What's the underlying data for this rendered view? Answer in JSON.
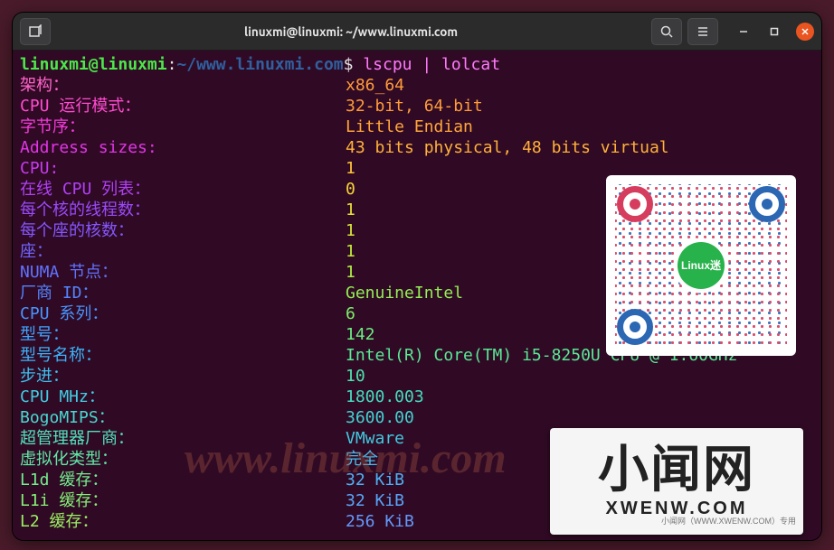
{
  "window": {
    "title": "linuxmi@linuxmi: ~/www.linuxmi.com"
  },
  "prompt": {
    "userhost": "linuxmi@linuxmi",
    "colon": ":",
    "path": "~/www.linuxmi.com",
    "dollar": "$ ",
    "command": "lscpu | lolcat"
  },
  "rows": [
    {
      "label": "架构：",
      "value": "x86_64"
    },
    {
      "label": "CPU 运行模式：",
      "value": "32-bit, 64-bit"
    },
    {
      "label": "字节序：",
      "value": "Little Endian"
    },
    {
      "label": "Address sizes:",
      "value": "43 bits physical, 48 bits virtual"
    },
    {
      "label": "CPU:",
      "value": "1"
    },
    {
      "label": "在线 CPU 列表：",
      "value": "0"
    },
    {
      "label": "每个核的线程数：",
      "value": "1"
    },
    {
      "label": "每个座的核数：",
      "value": "1"
    },
    {
      "label": "座：",
      "value": "1"
    },
    {
      "label": "NUMA 节点：",
      "value": "1"
    },
    {
      "label": "厂商 ID：",
      "value": "GenuineIntel"
    },
    {
      "label": "CPU 系列：",
      "value": "6"
    },
    {
      "label": "型号：",
      "value": "142"
    },
    {
      "label": "型号名称：",
      "value": "Intel(R) Core(TM) i5-8250U CPU @ 1.60GHz"
    },
    {
      "label": "步进：",
      "value": "10"
    },
    {
      "label": "CPU MHz：",
      "value": "1800.003"
    },
    {
      "label": "BogoMIPS：",
      "value": "3600.00"
    },
    {
      "label": "超管理器厂商：",
      "value": "VMware"
    },
    {
      "label": "虚拟化类型：",
      "value": "完全"
    },
    {
      "label": "L1d 缓存：",
      "value": "32 KiB"
    },
    {
      "label": "L1i 缓存：",
      "value": "32 KiB"
    },
    {
      "label": "L2 缓存：",
      "value": "256 KiB"
    }
  ],
  "qr": {
    "center_text": "Linux迷"
  },
  "badge": {
    "big": "小闻网",
    "small": "XWENW.COM",
    "foot": "小闻网（WWW.XWENW.COM）专用"
  },
  "watermark": "www.linuxmi.com"
}
